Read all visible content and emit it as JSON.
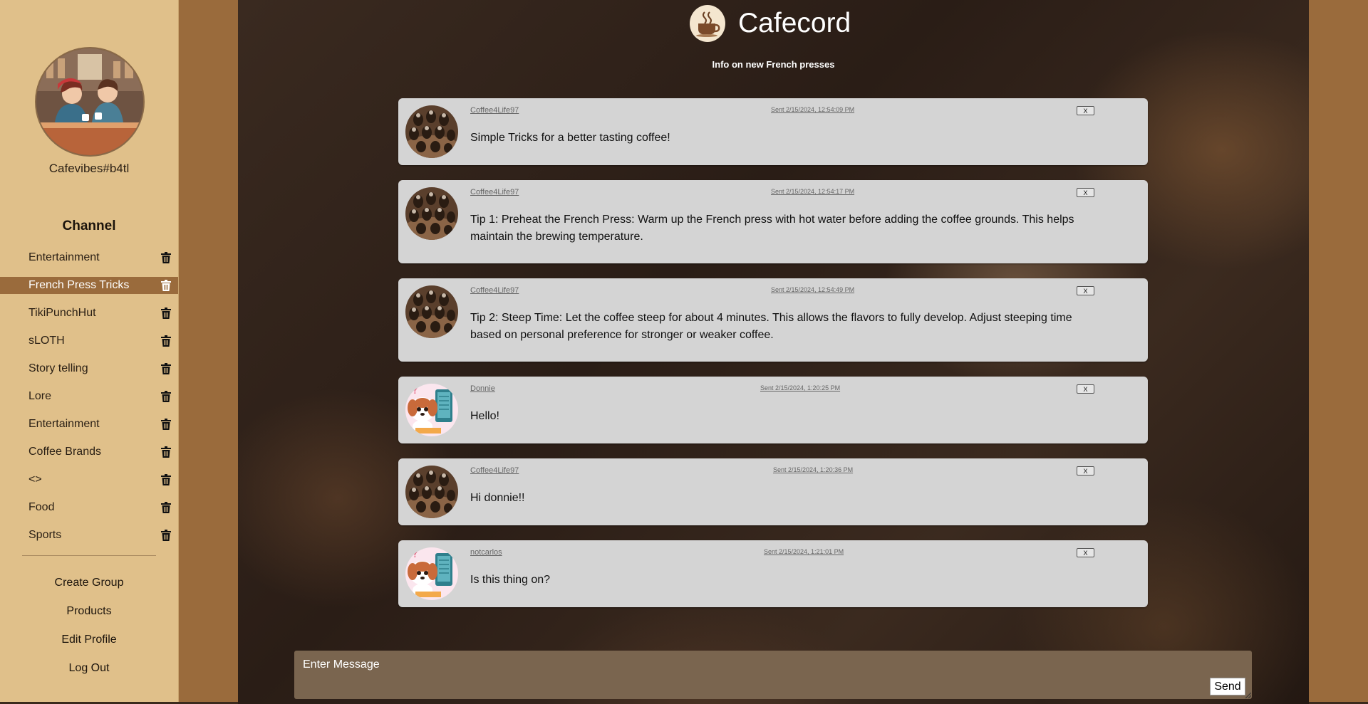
{
  "app": {
    "name": "Cafecord"
  },
  "user": {
    "username": "Cafevibes#b4tl"
  },
  "sidebar": {
    "channel_heading": "Channel",
    "channels": [
      {
        "label": "Entertainment",
        "active": false
      },
      {
        "label": "French Press Tricks",
        "active": true
      },
      {
        "label": "TikiPunchHut",
        "active": false
      },
      {
        "label": "sLOTH",
        "active": false
      },
      {
        "label": "Story telling",
        "active": false
      },
      {
        "label": "Lore",
        "active": false
      },
      {
        "label": "Entertainment",
        "active": false
      },
      {
        "label": "Coffee Brands",
        "active": false
      },
      {
        "label": "<>",
        "active": false
      },
      {
        "label": "Food",
        "active": false
      },
      {
        "label": "Sports",
        "active": false
      }
    ],
    "nav": [
      "Create Group",
      "Products",
      "Edit Profile",
      "Log Out"
    ],
    "trash_icon": "trash-icon"
  },
  "main": {
    "channel_description": "Info on new French presses",
    "messages": [
      {
        "author": "Coffee4Life97",
        "time": "Sent 2/15/2024, 12:54:09 PM",
        "delete_label": "X",
        "text": "Simple Tricks for a better tasting coffee!",
        "avatar": "coffee-beans"
      },
      {
        "author": "Coffee4Life97",
        "time": "Sent 2/15/2024, 12:54:17 PM",
        "delete_label": "X",
        "text": "Tip 1: Preheat the French Press: Warm up the French press with hot water before adding the coffee grounds. This helps maintain the brewing temperature.",
        "avatar": "coffee-beans"
      },
      {
        "author": "Coffee4Life97",
        "time": "Sent 2/15/2024, 12:54:49 PM",
        "delete_label": "X",
        "text": "Tip 2: Steep Time: Let the coffee steep for about 4 minutes. This allows the flavors to fully develop. Adjust steeping time based on personal preference for stronger or weaker coffee.",
        "avatar": "coffee-beans"
      },
      {
        "author": "Donnie",
        "time": "Sent 2/15/2024, 1:20:25 PM",
        "delete_label": "X",
        "text": "Hello!",
        "avatar": "puppy"
      },
      {
        "author": "Coffee4Life97",
        "time": "Sent 2/15/2024, 1:20:36 PM",
        "delete_label": "X",
        "text": "Hi donnie!!",
        "avatar": "coffee-beans"
      },
      {
        "author": "notcarlos",
        "time": "Sent 2/15/2024, 1:21:01 PM",
        "delete_label": "X",
        "text": "Is this thing on?",
        "avatar": "puppy"
      }
    ]
  },
  "composer": {
    "placeholder": "Enter Message",
    "send_label": "Send"
  },
  "colors": {
    "sidebar_bg": "#e0c08a",
    "accent": "#9a6b3c",
    "message_bg": "#d4d4d4",
    "composer_bg": "#7a654f"
  }
}
